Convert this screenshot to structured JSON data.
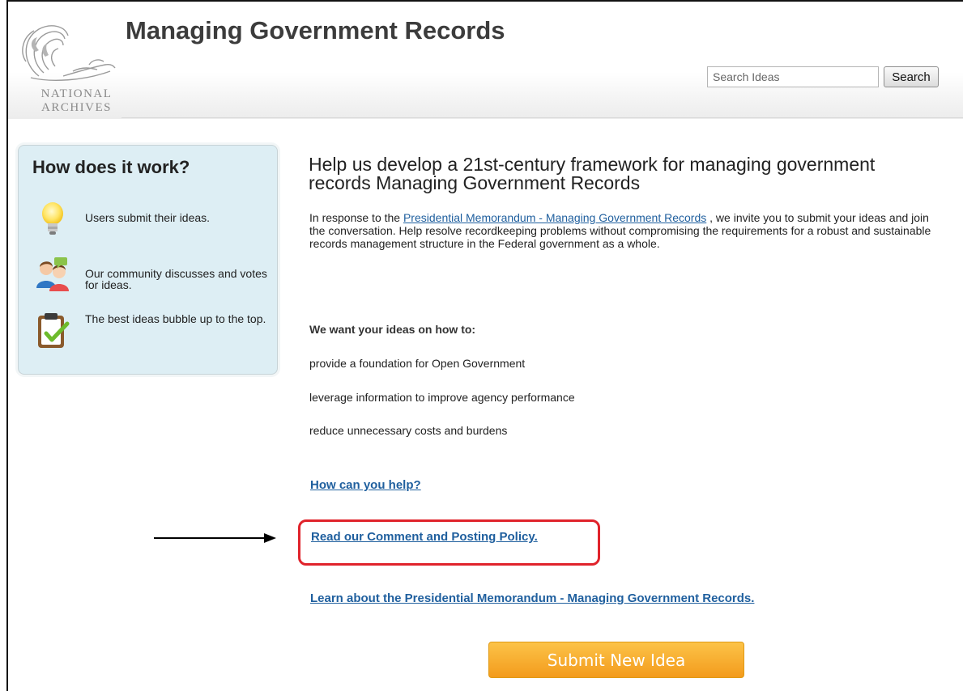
{
  "header": {
    "logo_line1": "NATIONAL",
    "logo_line2": "ARCHIVES",
    "title": "Managing Government Records",
    "search_placeholder": "Search Ideas",
    "search_button": "Search"
  },
  "how_it_works": {
    "title": "How does it work?",
    "steps": [
      {
        "icon": "lightbulb-icon",
        "text": "Users submit their ideas."
      },
      {
        "icon": "community-icon",
        "text": "Our community discusses and votes for ideas."
      },
      {
        "icon": "clipboard-check-icon",
        "text": "The best ideas bubble up to the top."
      }
    ]
  },
  "main": {
    "heading": "Help us develop a 21st-century framework for managing government records Managing Government Records",
    "intro_before": "In response to the ",
    "intro_link": "Presidential Memorandum - Managing Government Records",
    "intro_after": " , we invite you to submit your ideas and join the conversation. Help resolve recordkeeping problems without compromising the requirements for a robust and sustainable records management structure in the Federal government as a whole.",
    "want_heading": "We want your ideas on how to:",
    "ideas": [
      "provide a foundation for Open Government",
      "leverage information to improve agency performance",
      "reduce unnecessary costs and burdens"
    ],
    "links": {
      "help": "How can you help?",
      "policy": "Read our Comment and Posting Policy.",
      "memorandum": "Learn about the Presidential Memorandum - Managing Government Records."
    },
    "submit_button": "Submit New Idea"
  },
  "colors": {
    "link": "#1f5f9e",
    "highlight": "#e0232b",
    "submit": "#f39b1d",
    "box_bg": "#ddeef4"
  }
}
